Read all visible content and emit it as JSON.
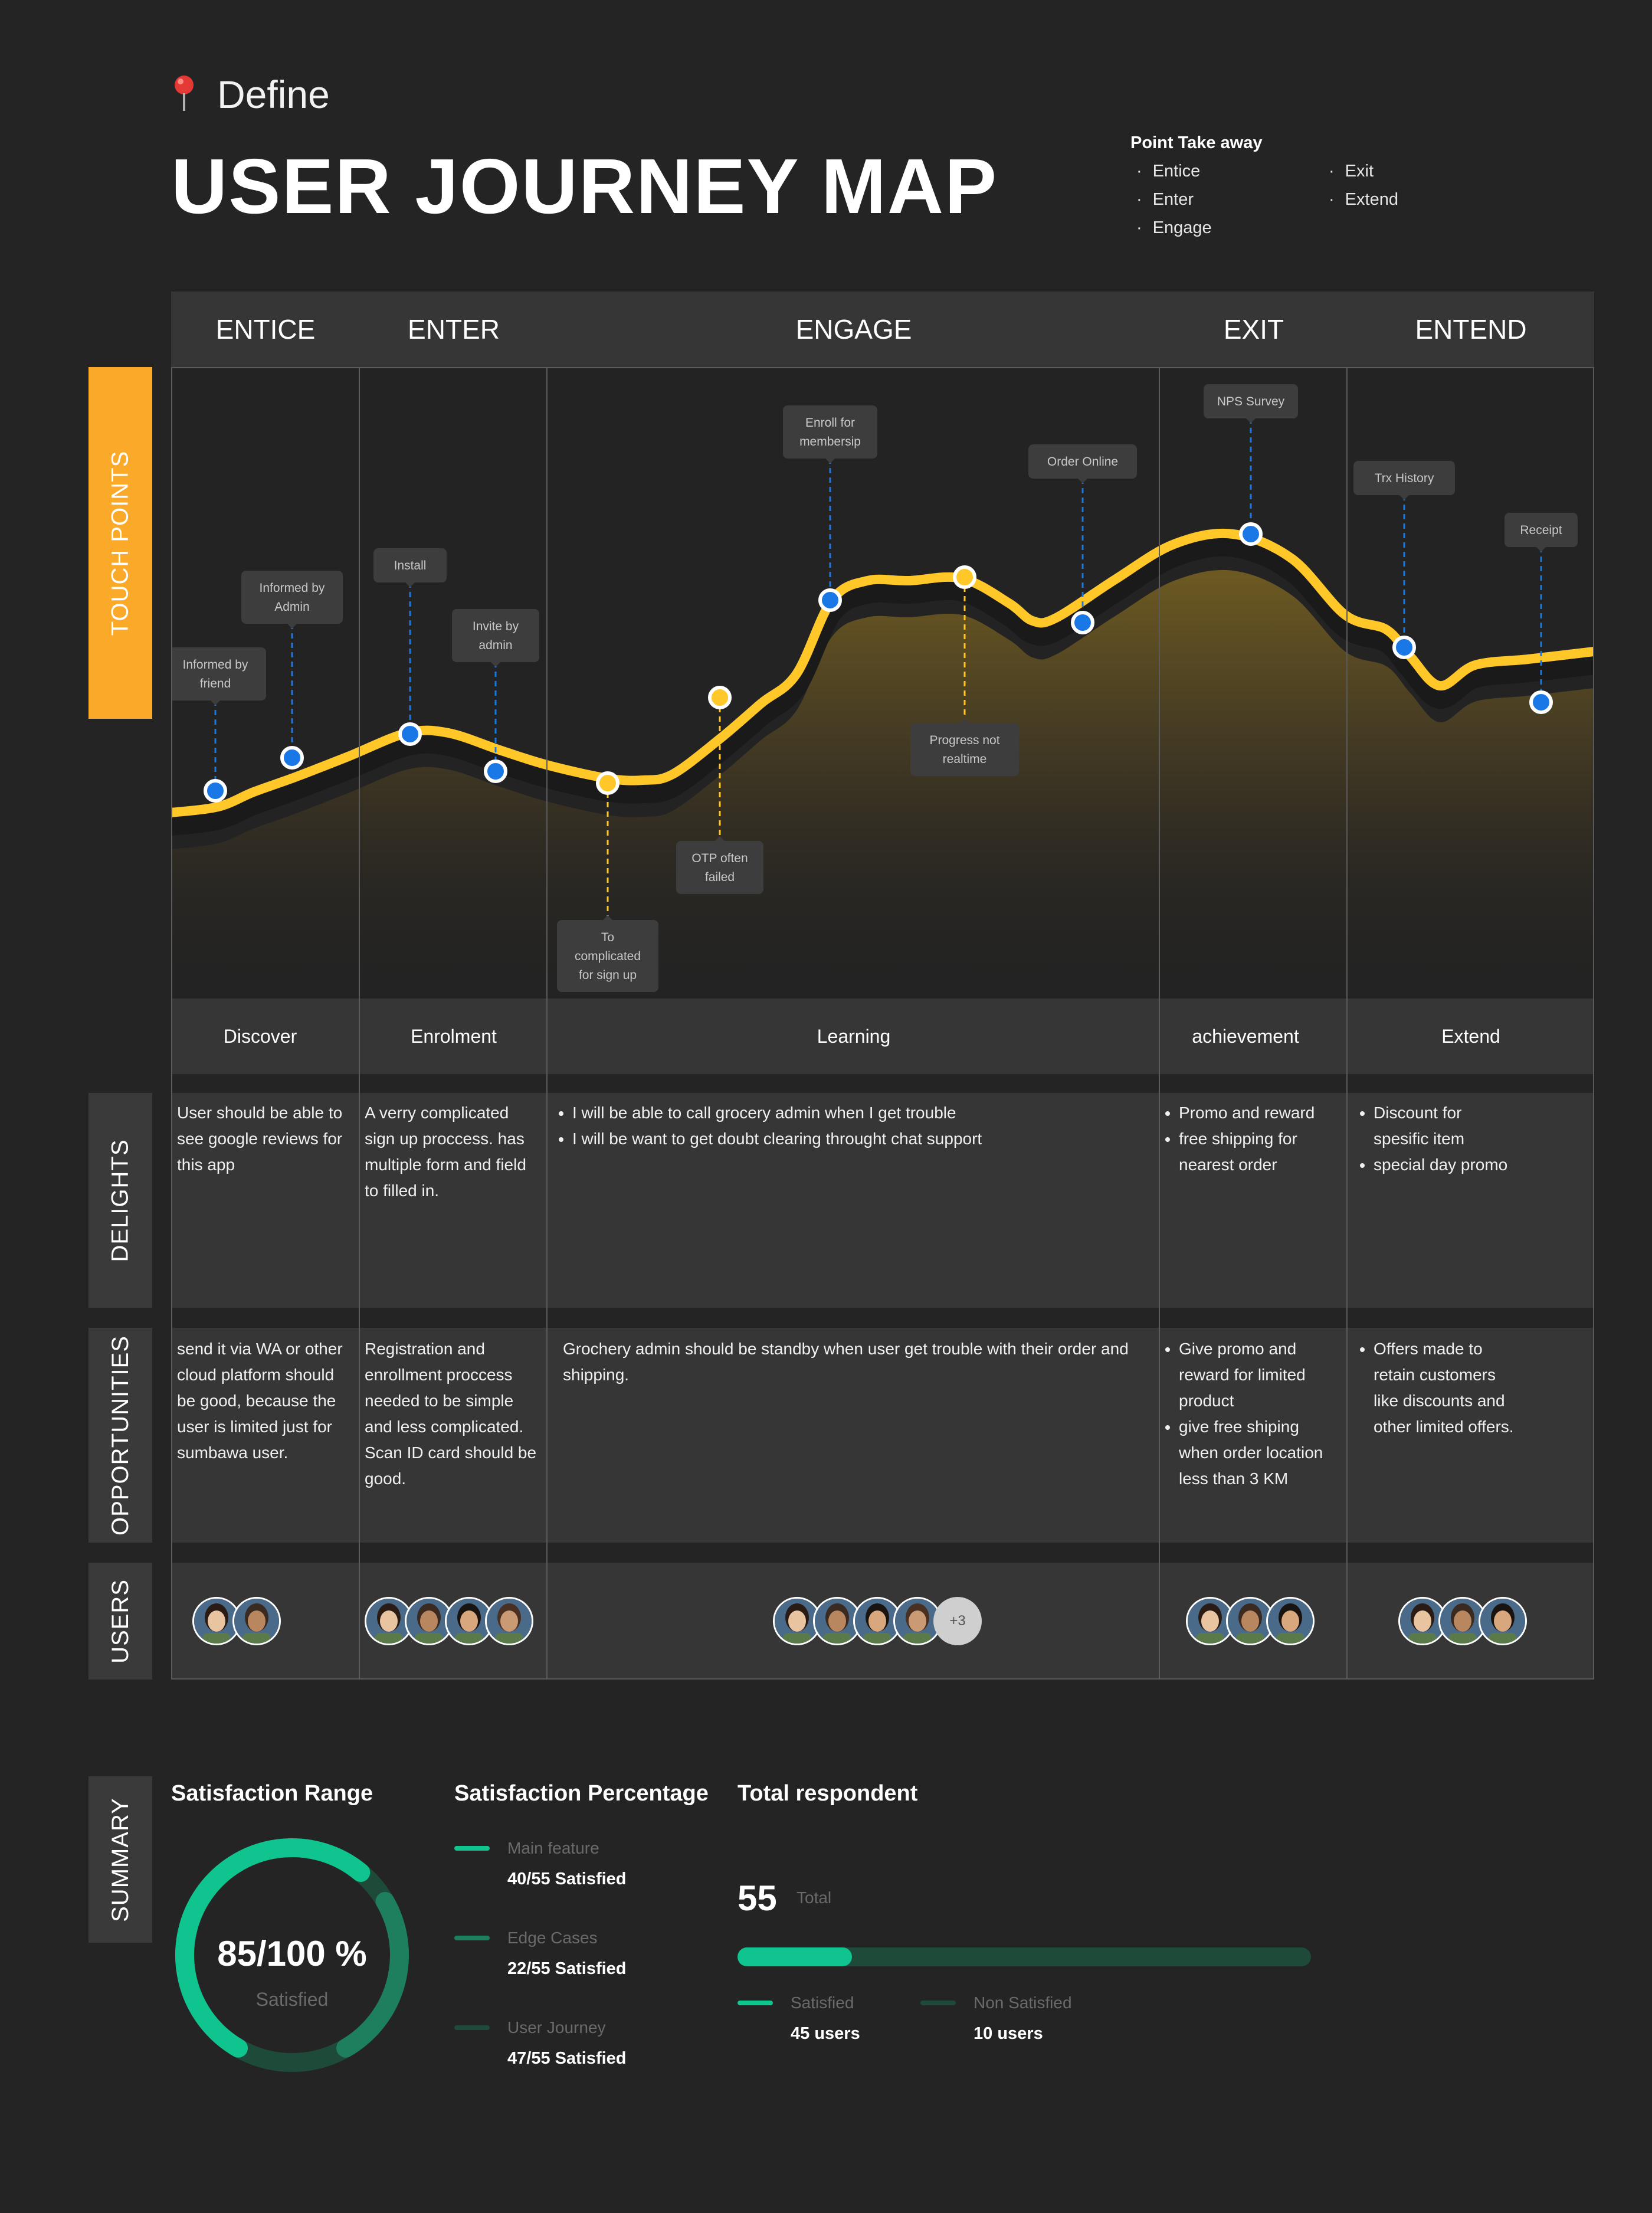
{
  "header": {
    "define_label": "Define",
    "title": "USER JOURNEY MAP",
    "takeaway_title": "Point Take away",
    "takeaway_items": [
      "Entice",
      "Enter",
      "Engage",
      "Exit",
      "Extend"
    ]
  },
  "phases": [
    "ENTICE",
    "ENTER",
    "ENGAGE",
    "EXIT",
    "ENTEND"
  ],
  "side_tabs": {
    "touch_points": "TOUCH POINTS",
    "delights": "DELIGHTS",
    "opportunities": "OPPORTUNITIES",
    "users": "USERS",
    "summary": "SUMMARY"
  },
  "touchpoints": [
    {
      "label": "Informed by friend",
      "positive": true
    },
    {
      "label": "Informed by Admin",
      "positive": true
    },
    {
      "label": "Install",
      "positive": true
    },
    {
      "label": "Invite by admin",
      "positive": true
    },
    {
      "label": "To complicated for sign up",
      "positive": false
    },
    {
      "label": "OTP often failed",
      "positive": false
    },
    {
      "label": "Enroll for membersip",
      "positive": true
    },
    {
      "label": "Progress not realtime",
      "positive": false
    },
    {
      "label": "Order Online",
      "positive": true
    },
    {
      "label": "NPS Survey",
      "positive": true
    },
    {
      "label": "Trx History",
      "positive": true
    },
    {
      "label": "Receipt",
      "positive": true
    }
  ],
  "stages": [
    "Discover",
    "Enrolment",
    "Learning",
    "achievement",
    "Extend"
  ],
  "delights": {
    "discover": "User should be able to see google reviews for this app",
    "enrolment": "A verry complicated sign up proccess. has multiple form and field to filled in.",
    "learning": [
      "I will be able to call grocery admin when I get trouble",
      "I will be want to get doubt clearing throught chat support"
    ],
    "achievement": [
      "Promo and reward",
      "free shipping for nearest order"
    ],
    "extend": [
      "Discount for spesific item",
      "special day promo"
    ]
  },
  "opportunities": {
    "discover": "send it via WA or other cloud platform should be good, because the user is limited just for sumbawa user.",
    "enrolment": "Registration and enrollment proccess needed to be simple and less complicated. Scan ID card should be good.",
    "learning": "Grochery admin should be standby when user get trouble with their order and shipping.",
    "achievement": [
      "Give promo and reward for limited product",
      "give free shiping when order location less than 3 KM"
    ],
    "extend": [
      "Offers made to retain customers like discounts and other limited offers."
    ]
  },
  "users": {
    "discover_count": 2,
    "enrolment_count": 4,
    "learning_count": 4,
    "learning_more": "+3",
    "achievement_count": 3,
    "extend_count": 3
  },
  "summary": {
    "range_title": "Satisfaction Range",
    "range_value": "85/100 %",
    "range_label": "Satisfied",
    "range_fraction": 0.85,
    "percentage_title": "Satisfaction Percentage",
    "items": [
      {
        "label": "Main feature",
        "value": "40/55 Satisfied",
        "color": "#0fc48e"
      },
      {
        "label": "Edge Cases",
        "value": "22/55 Satisfied",
        "color": "#1e7f5e"
      },
      {
        "label": "User Journey",
        "value": "47/55 Satisfied",
        "color": "#1e4a3a"
      }
    ],
    "respondent_title": "Total respondent",
    "total": "55",
    "total_label": "Total",
    "satisfied_fraction": 0.2,
    "satisfied_label": "Satisfied",
    "satisfied_value": "45 users",
    "non_label": "Non Satisfied",
    "non_value": "10 users"
  },
  "colors": {
    "accent_yellow": "#ffc727",
    "orange_tab": "#fba928",
    "blue_point": "#1a78e6",
    "green": "#0fc48e",
    "dark_green": "#1e4a3a"
  }
}
